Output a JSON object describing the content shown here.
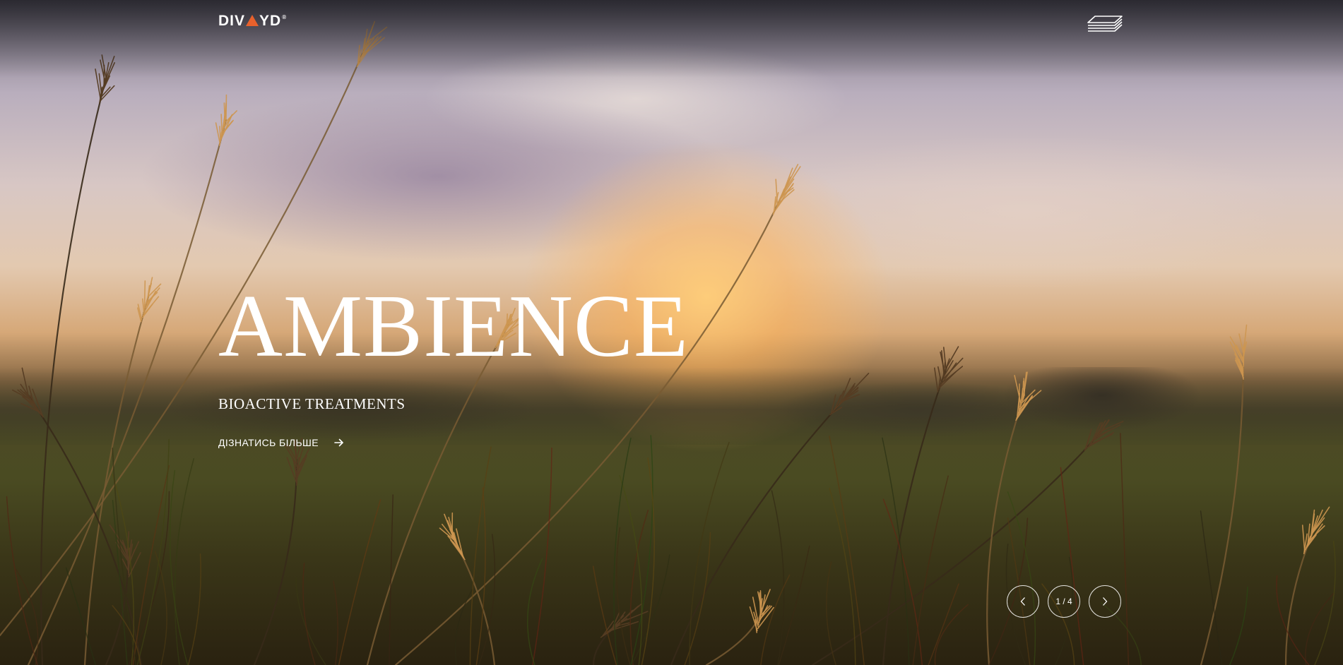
{
  "header": {
    "logo": {
      "text_left": "DIV",
      "text_right": "YD",
      "registered": "®",
      "accent_color": "#e8612c"
    },
    "menu_icon": "layers-icon"
  },
  "slide": {
    "title": "AMBIENCE",
    "subtitle": "BIOACTIVE TREATMENTS",
    "cta_label": "ДІЗНАТИСЬ БІЛЬШЕ",
    "cta_icon": "arrow-right-icon"
  },
  "slider": {
    "prev_icon": "chevron-left-icon",
    "next_icon": "chevron-right-icon",
    "counter": "1 / 4"
  }
}
